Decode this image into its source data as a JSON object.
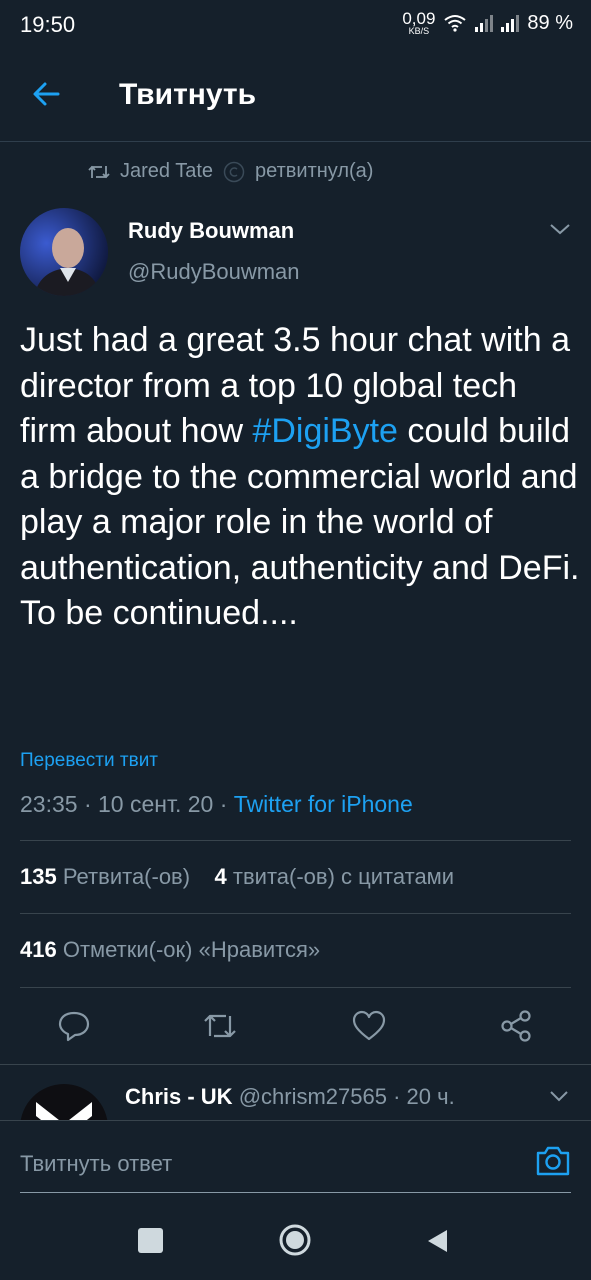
{
  "status_bar": {
    "time": "19:50",
    "net_speed_value": "0,09",
    "net_speed_unit": "KB/S",
    "battery": "89 %"
  },
  "header": {
    "title": "Твитнуть",
    "back_icon": "arrow-left-icon"
  },
  "retweet_banner": {
    "user": "Jared Tate",
    "label": "ретвитнул(а)"
  },
  "tweet": {
    "author_name": "Rudy Bouwman",
    "author_handle": "@RudyBouwman",
    "text_before": "Just had a great 3.5 hour chat with a director from a top  10 global tech firm about how ",
    "hashtag": "#DigiByte",
    "text_after": " could build a bridge to the commercial world and play a major role in the world of authentication, authenticity and DeFi.",
    "text_last": "To be continued....",
    "translate_label": "Перевести твит",
    "time": "23:35",
    "date": "10 сент. 20",
    "source": "Twitter for iPhone",
    "retweets_count": "135",
    "retweets_label": "Ретвита(-ов)",
    "quotes_count": "4",
    "quotes_label": "твита(-ов) с цитатами",
    "likes_count": "416",
    "likes_label": "Отметки(-ок) «Нравится»"
  },
  "reply_preview": {
    "name": "Chris - UK",
    "handle_time": "@chrism27565 · 20 ч."
  },
  "composer": {
    "placeholder": "Твитнуть ответ",
    "camera_icon": "camera-icon"
  },
  "colors": {
    "background": "#15202b",
    "accent": "#1da1f2",
    "secondary_text": "#8899a6",
    "divider": "#38444d"
  }
}
